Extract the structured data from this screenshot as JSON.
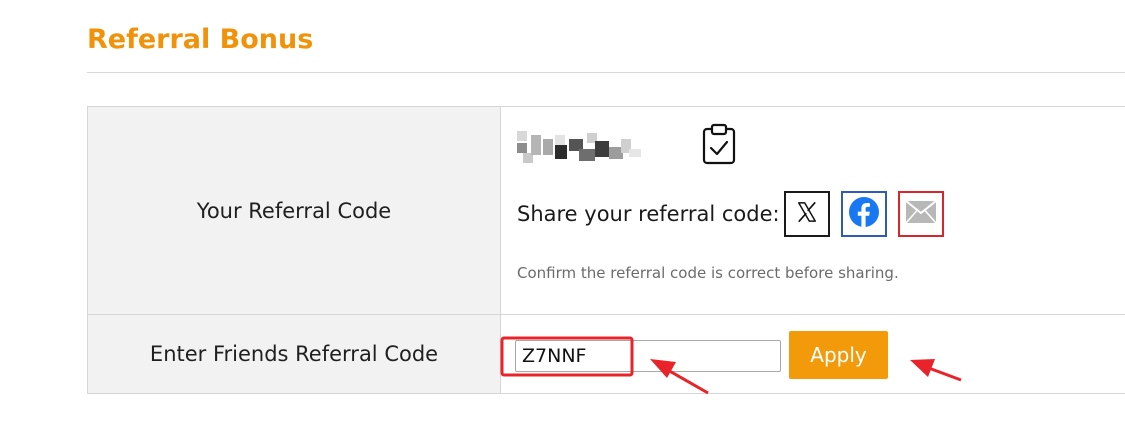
{
  "page": {
    "title": "Referral Bonus"
  },
  "referral": {
    "your_code_label": "Your Referral Code",
    "share_label": "Share your referral code:",
    "share_buttons": {
      "x_icon": "x-logo-icon",
      "facebook_icon": "facebook-icon",
      "email_icon": "envelope-icon"
    },
    "hint": "Confirm the referral code is correct before sharing."
  },
  "friend": {
    "label": "Enter Friends Referral Code",
    "input_value": "Z7NNF",
    "apply_label": "Apply"
  },
  "colors": {
    "accent": "#f39a0b",
    "title": "#f0930b",
    "annotation": "#e8232a",
    "facebook": "#1877f2",
    "x_border": "#1a1a1a",
    "facebook_border": "#2f5bb7",
    "mail_border": "#d9262c"
  }
}
